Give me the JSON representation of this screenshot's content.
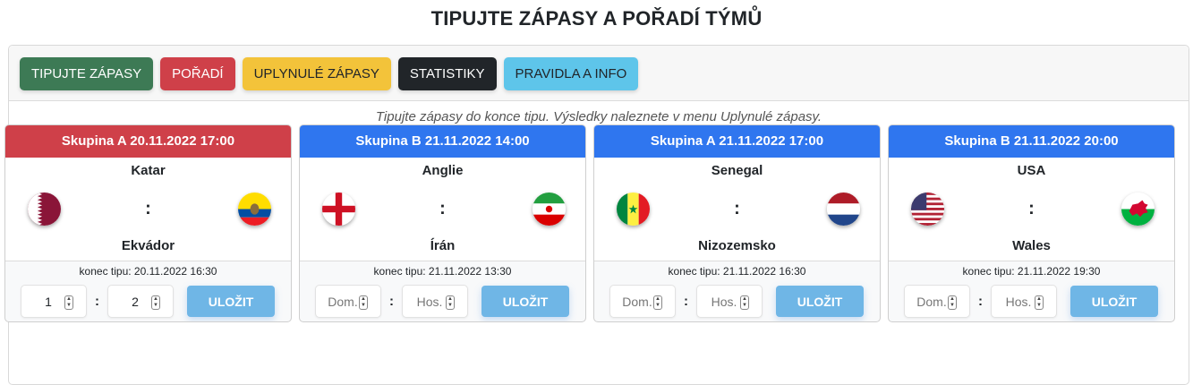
{
  "page": {
    "title": "TIPUJTE ZÁPASY A POŘADÍ TÝMŮ"
  },
  "nav": {
    "tabs": [
      {
        "label": "TIPUJTE ZÁPASY",
        "bg": "#3d7a55",
        "fg": "#ffffff"
      },
      {
        "label": "POŘADÍ",
        "bg": "#cf4049",
        "fg": "#ffffff"
      },
      {
        "label": "UPLYNULÉ ZÁPASY",
        "bg": "#f3c33a",
        "fg": "#212529"
      },
      {
        "label": "STATISTIKY",
        "bg": "#212529",
        "fg": "#ffffff"
      },
      {
        "label": "PRAVIDLA A INFO",
        "bg": "#5ec5ea",
        "fg": "#212529"
      }
    ]
  },
  "info_text": "Tipujte zápasy do konce tipu. Výsledky naleznete v menu Uplynulé zápasy.",
  "colors": {
    "group_a_current": "#cf4049",
    "group_header_blue": "#2f76ef",
    "save_button": "#6fb6e6"
  },
  "matches": [
    {
      "header": "Skupina A 20.11.2022 17:00",
      "header_color": "#cf4049",
      "home": "Katar",
      "away": "Ekvádor",
      "home_flag": "qatar-flag",
      "away_flag": "ecuador-flag",
      "separator": ":",
      "deadline": "konec tipu: 20.11.2022 16:30",
      "home_score": "1",
      "away_score": "2",
      "home_placeholder": "",
      "away_placeholder": "",
      "save_label": "ULOŽIT"
    },
    {
      "header": "Skupina B 21.11.2022 14:00",
      "header_color": "#2f76ef",
      "home": "Anglie",
      "away": "Írán",
      "home_flag": "england-flag",
      "away_flag": "iran-flag",
      "separator": ":",
      "deadline": "konec tipu: 21.11.2022 13:30",
      "home_score": "",
      "away_score": "",
      "home_placeholder": "Dom.",
      "away_placeholder": "Hos.",
      "save_label": "ULOŽIT"
    },
    {
      "header": "Skupina A 21.11.2022 17:00",
      "header_color": "#2f76ef",
      "home": "Senegal",
      "away": "Nizozemsko",
      "home_flag": "senegal-flag",
      "away_flag": "netherlands-flag",
      "separator": ":",
      "deadline": "konec tipu: 21.11.2022 16:30",
      "home_score": "",
      "away_score": "",
      "home_placeholder": "Dom.",
      "away_placeholder": "Hos.",
      "save_label": "ULOŽIT"
    },
    {
      "header": "Skupina B 21.11.2022 20:00",
      "header_color": "#2f76ef",
      "home": "USA",
      "away": "Wales",
      "home_flag": "usa-flag",
      "away_flag": "wales-flag",
      "separator": ":",
      "deadline": "konec tipu: 21.11.2022 19:30",
      "home_score": "",
      "away_score": "",
      "home_placeholder": "Dom.",
      "away_placeholder": "Hos.",
      "save_label": "ULOŽIT"
    }
  ]
}
